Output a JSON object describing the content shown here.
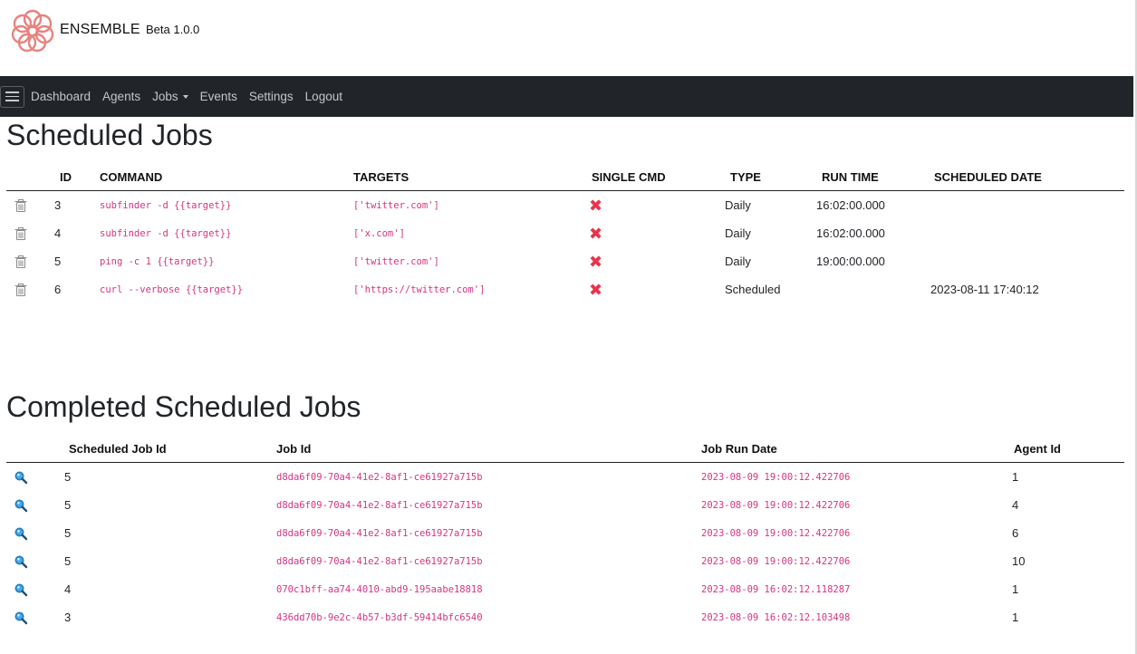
{
  "app": {
    "name": "ENSEMBLE",
    "version": "Beta 1.0.0"
  },
  "nav": {
    "items": [
      "Dashboard",
      "Agents",
      "Jobs",
      "Events",
      "Settings",
      "Logout"
    ]
  },
  "scheduled": {
    "title": "Scheduled Jobs",
    "headers": [
      "",
      "ID",
      "COMMAND",
      "TARGETS",
      "SINGLE CMD",
      "TYPE",
      "RUN TIME",
      "SCHEDULED DATE"
    ],
    "rows": [
      {
        "id": "3",
        "command": "subfinder -d {{target}}",
        "targets": "['twitter.com']",
        "single_cmd": "✖",
        "type": "Daily",
        "run_time": "16:02:00.000",
        "scheduled_date": ""
      },
      {
        "id": "4",
        "command": "subfinder -d {{target}}",
        "targets": "['x.com']",
        "single_cmd": "✖",
        "type": "Daily",
        "run_time": "16:02:00.000",
        "scheduled_date": ""
      },
      {
        "id": "5",
        "command": "ping -c 1 {{target}}",
        "targets": "['twitter.com']",
        "single_cmd": "✖",
        "type": "Daily",
        "run_time": "19:00:00.000",
        "scheduled_date": ""
      },
      {
        "id": "6",
        "command": "curl --verbose {{target}}",
        "targets": "['https://twitter.com']",
        "single_cmd": "✖",
        "type": "Scheduled",
        "run_time": "",
        "scheduled_date": "2023-08-11 17:40:12"
      }
    ]
  },
  "completed": {
    "title": "Completed Scheduled Jobs",
    "headers": [
      "",
      "Scheduled Job Id",
      "Job Id",
      "Job Run Date",
      "Agent Id"
    ],
    "rows": [
      {
        "scheduled_job_id": "5",
        "job_id": "d8da6f09-70a4-41e2-8af1-ce61927a715b",
        "run_date": "2023-08-09 19:00:12.422706",
        "agent_id": "1"
      },
      {
        "scheduled_job_id": "5",
        "job_id": "d8da6f09-70a4-41e2-8af1-ce61927a715b",
        "run_date": "2023-08-09 19:00:12.422706",
        "agent_id": "4"
      },
      {
        "scheduled_job_id": "5",
        "job_id": "d8da6f09-70a4-41e2-8af1-ce61927a715b",
        "run_date": "2023-08-09 19:00:12.422706",
        "agent_id": "6"
      },
      {
        "scheduled_job_id": "5",
        "job_id": "d8da6f09-70a4-41e2-8af1-ce61927a715b",
        "run_date": "2023-08-09 19:00:12.422706",
        "agent_id": "10"
      },
      {
        "scheduled_job_id": "4",
        "job_id": "070c1bff-aa74-4010-abd9-195aabe18818",
        "run_date": "2023-08-09 16:02:12.118287",
        "agent_id": "1"
      },
      {
        "scheduled_job_id": "3",
        "job_id": "436dd70b-9e2c-4b57-b3df-59414bfc6540",
        "run_date": "2023-08-09 16:02:12.103498",
        "agent_id": "1"
      }
    ]
  },
  "icons": {
    "logo": "ensemble-logo-icon",
    "menu": "hamburger-menu-icon",
    "delete": "trash-icon",
    "view": "magnifier-icon",
    "single_cmd_false": "x-mark-icon"
  },
  "colors": {
    "navbar": "#212529",
    "code": "#d63384",
    "x_mark": "#e8334a",
    "logo": "#e8827e",
    "search_icon": "#1f7fc4"
  }
}
